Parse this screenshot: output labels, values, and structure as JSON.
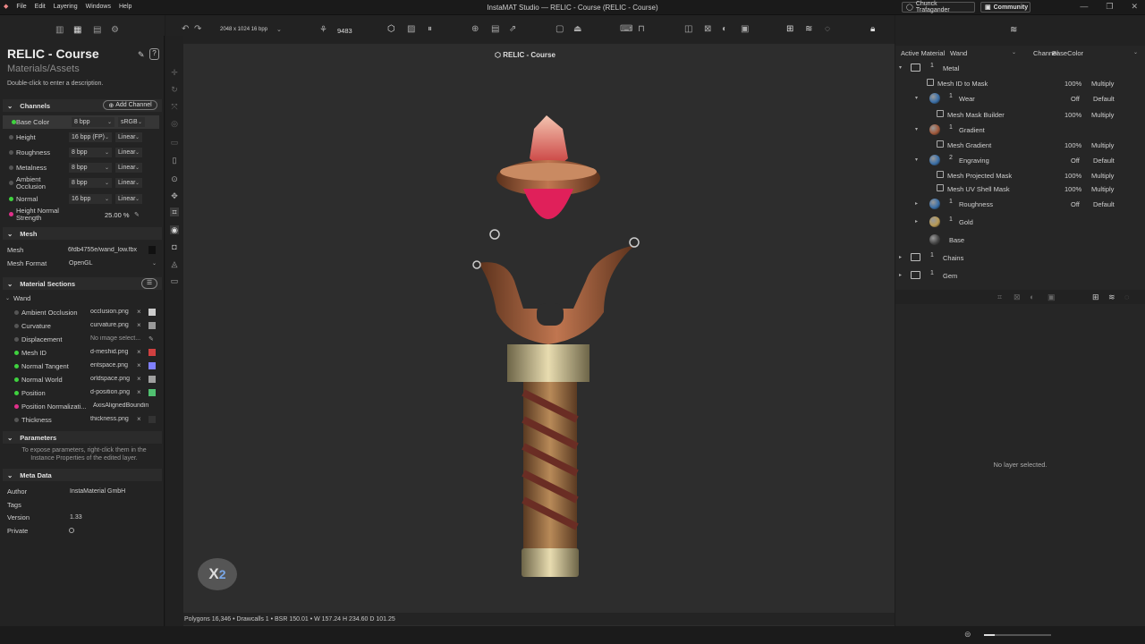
{
  "menu": [
    "File",
    "Edit",
    "Layering",
    "Windows",
    "Help"
  ],
  "app_title": "InstaMAT Studio —  RELIC - Course (RELIC - Course)",
  "user": "Chunck Trafagander",
  "community": "Community",
  "toolbar": {
    "resolution": "2048 x 1024 16 bpp",
    "count": "9483"
  },
  "asset": {
    "title": "RELIC - Course",
    "path": "Materials/Assets",
    "description": "Double-click to enter a description."
  },
  "channels": {
    "header": "Channels",
    "add_label": "Add Channel",
    "rows": [
      {
        "name": "Base Color",
        "depth": "8 bpp",
        "space": "sRGB",
        "active": true,
        "color": "#3fd23f"
      },
      {
        "name": "Height",
        "depth": "16 bpp (FP)",
        "space": "Linear",
        "active": false,
        "color": "#555555"
      },
      {
        "name": "Roughness",
        "depth": "8 bpp",
        "space": "Linear",
        "active": false,
        "color": "#555555"
      },
      {
        "name": "Metalness",
        "depth": "8 bpp",
        "space": "Linear",
        "active": false,
        "color": "#555555"
      },
      {
        "name": "Ambient Occlusion",
        "depth": "8 bpp",
        "space": "Linear",
        "active": false,
        "color": "#555555"
      },
      {
        "name": "Normal",
        "depth": "16 bpp",
        "space": "Linear",
        "active": false,
        "color": "#3fd23f"
      }
    ],
    "height_normal": {
      "name": "Height Normal Strength",
      "value": "25.00 %"
    }
  },
  "mesh": {
    "header": "Mesh",
    "mesh_label": "Mesh",
    "mesh_value": "6fdb4755e/wand_low.fbx",
    "format_label": "Mesh Format",
    "format_value": "OpenGL"
  },
  "material_sections": {
    "header": "Material Sections",
    "group": "Wand",
    "rows": [
      {
        "name": "Ambient Occlusion",
        "file": "occlusion.png",
        "dot": "#555555",
        "swatch": "#cccccc"
      },
      {
        "name": "Curvature",
        "file": "curvature.png",
        "dot": "#555555",
        "swatch": "#999999"
      },
      {
        "name": "Displacement",
        "file": "No image select...",
        "dot": "#555555",
        "swatch": ""
      },
      {
        "name": "Mesh ID",
        "file": "d-meshid.png",
        "dot": "#3fd23f",
        "swatch": "#d04040"
      },
      {
        "name": "Normal Tangent",
        "file": "entspace.png",
        "dot": "#3fd23f",
        "swatch": "#8080ff"
      },
      {
        "name": "Normal World",
        "file": "orldspace.png",
        "dot": "#3fd23f",
        "swatch": "#a0a0a0"
      },
      {
        "name": "Position",
        "file": "d-position.png",
        "dot": "#3fd23f",
        "swatch": "#50c070"
      },
      {
        "name": "Position Normalizati...",
        "file": "AxisAlignedBoundin",
        "dot": "#e0308a",
        "swatch": ""
      },
      {
        "name": "Thickness",
        "file": "thickness.png",
        "dot": "#555555",
        "swatch": "#333333"
      }
    ]
  },
  "parameters": {
    "header": "Parameters",
    "hint": "To expose parameters, right-click them in the Instance Properties of the edited layer."
  },
  "meta": {
    "header": "Meta Data",
    "author_label": "Author",
    "author": "InstaMaterial GmbH",
    "tags_label": "Tags",
    "version_label": "Version",
    "version": "1.33",
    "private_label": "Private"
  },
  "viewport": {
    "title": "RELIC - Course",
    "status": "Polygons 16,346 • Drawcalls 1 • BSR 150.01 • W 157.24 H 234.60 D 101.25"
  },
  "layers": {
    "active_material_label": "Active Material",
    "active_material": "Wand",
    "channel_label": "Channel",
    "channel": "BaseColor",
    "empty": "No layer selected.",
    "rows": [
      {
        "name": "Metal",
        "count": "1",
        "type": "folder",
        "depth": 0,
        "pct": "",
        "blend": ""
      },
      {
        "name": "Mesh ID to Mask",
        "count": "",
        "type": "mask",
        "depth": 1,
        "pct": "100%",
        "blend": "Multiply"
      },
      {
        "name": "Wear",
        "count": "1",
        "type": "ball",
        "depth": 1,
        "pct": "Off",
        "blend": "Default",
        "ball": "#3a6fa8"
      },
      {
        "name": "Mesh Mask Builder",
        "count": "",
        "type": "mask",
        "depth": 2,
        "pct": "100%",
        "blend": "Multiply"
      },
      {
        "name": "Gradient",
        "count": "1",
        "type": "ball",
        "depth": 1,
        "pct": "",
        "blend": "",
        "ball": "#a0583a"
      },
      {
        "name": "Mesh Gradient",
        "count": "",
        "type": "mask",
        "depth": 2,
        "pct": "100%",
        "blend": "Multiply"
      },
      {
        "name": "Engraving",
        "count": "2",
        "type": "ball",
        "depth": 1,
        "pct": "Off",
        "blend": "Default",
        "ball": "#3a6fa8"
      },
      {
        "name": "Mesh Projected Mask",
        "count": "",
        "type": "mask",
        "depth": 2,
        "pct": "100%",
        "blend": "Multiply"
      },
      {
        "name": "Mesh UV Shell Mask",
        "count": "",
        "type": "mask",
        "depth": 2,
        "pct": "100%",
        "blend": "Multiply"
      },
      {
        "name": "Roughness",
        "count": "1",
        "type": "ball",
        "depth": 1,
        "pct": "Off",
        "blend": "Default",
        "ball": "#3a6fa8"
      },
      {
        "name": "Gold",
        "count": "1",
        "type": "ball",
        "depth": 1,
        "pct": "",
        "blend": "",
        "ball": "#b89a55"
      },
      {
        "name": "Base",
        "count": "",
        "type": "ball",
        "depth": 1,
        "pct": "",
        "blend": "",
        "ball": "#444444"
      },
      {
        "name": "Chains",
        "count": "1",
        "type": "folder",
        "depth": 0,
        "pct": "",
        "blend": ""
      },
      {
        "name": "Gem",
        "count": "1",
        "type": "folder",
        "depth": 0,
        "pct": "",
        "blend": ""
      }
    ]
  }
}
